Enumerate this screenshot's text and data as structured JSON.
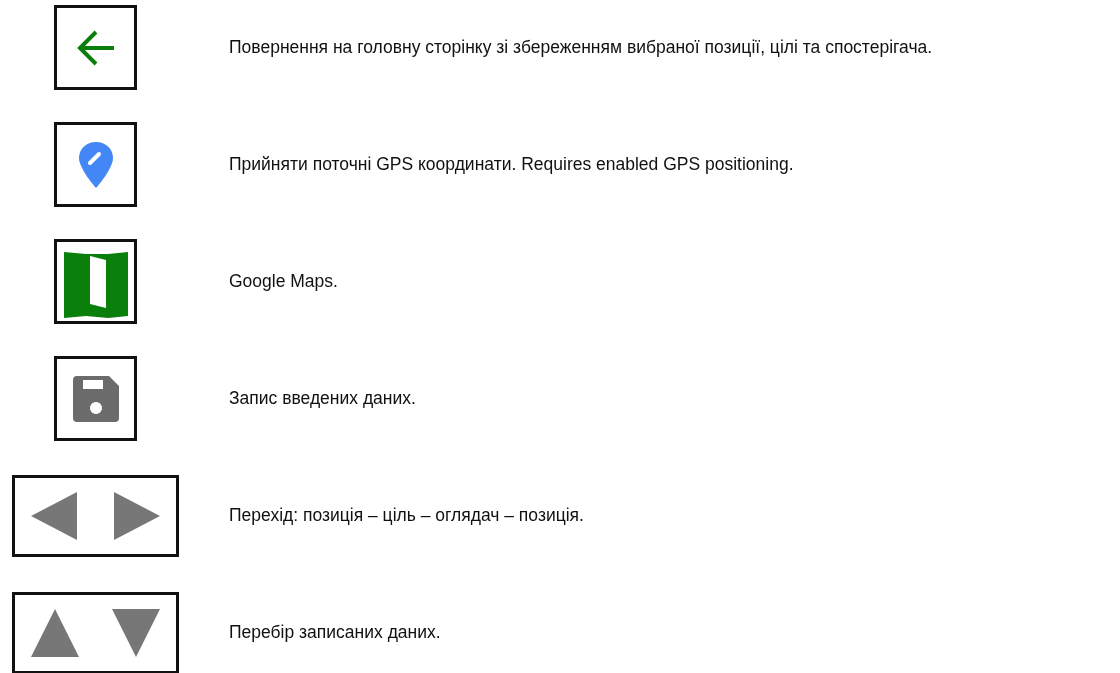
{
  "items": [
    {
      "kind": "back",
      "text": "Повернення на головну сторінку зі збереженням вибраної позиції, цілі та спостерігача."
    },
    {
      "kind": "gps",
      "text": "Прийняти поточні GPS координати. Requires enabled GPS positioning."
    },
    {
      "kind": "map",
      "text": "Google Maps."
    },
    {
      "kind": "save",
      "text": "Запис введених даних."
    },
    {
      "kind": "left-right",
      "text": "Перехід: позиція – ціль – оглядач – позиція."
    },
    {
      "kind": "up-down",
      "text": "Перебір записаних даних."
    }
  ]
}
